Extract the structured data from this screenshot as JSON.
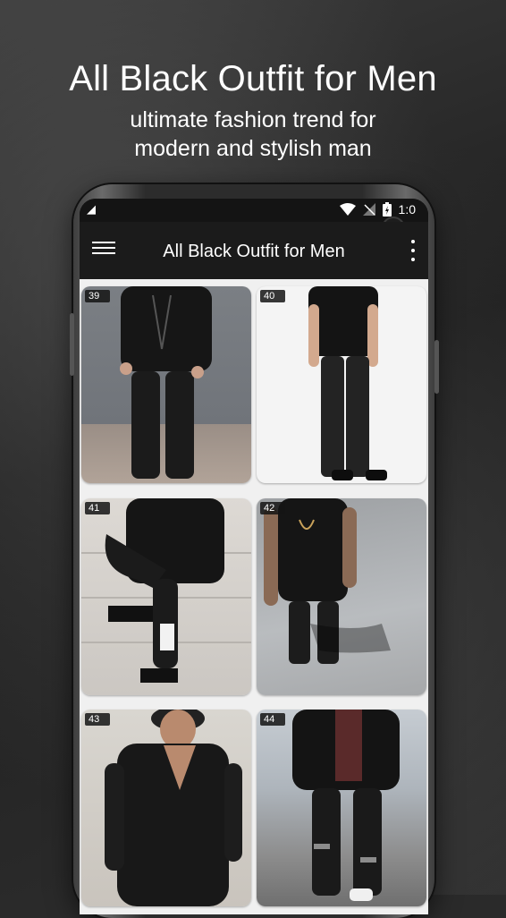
{
  "promo": {
    "headline": "All Black Outfit for Men",
    "subline_1": "ultimate fashion trend for",
    "subline_2": "modern and stylish man"
  },
  "status_bar": {
    "time": "1:0",
    "icons": [
      "wifi-icon",
      "no-signal-icon",
      "battery-charging-icon"
    ]
  },
  "app_bar": {
    "title": "All Black Outfit for Men",
    "left_icon": "hamburger-menu-icon",
    "right_icon": "overflow-menu-icon"
  },
  "gallery": {
    "items": [
      {
        "number": "39"
      },
      {
        "number": "40"
      },
      {
        "number": "41"
      },
      {
        "number": "42"
      },
      {
        "number": "43"
      },
      {
        "number": "44"
      }
    ]
  },
  "colors": {
    "app_bar_bg": "#1b1b1b",
    "grid_bg": "#f0f0f0",
    "text": "#ffffff"
  }
}
